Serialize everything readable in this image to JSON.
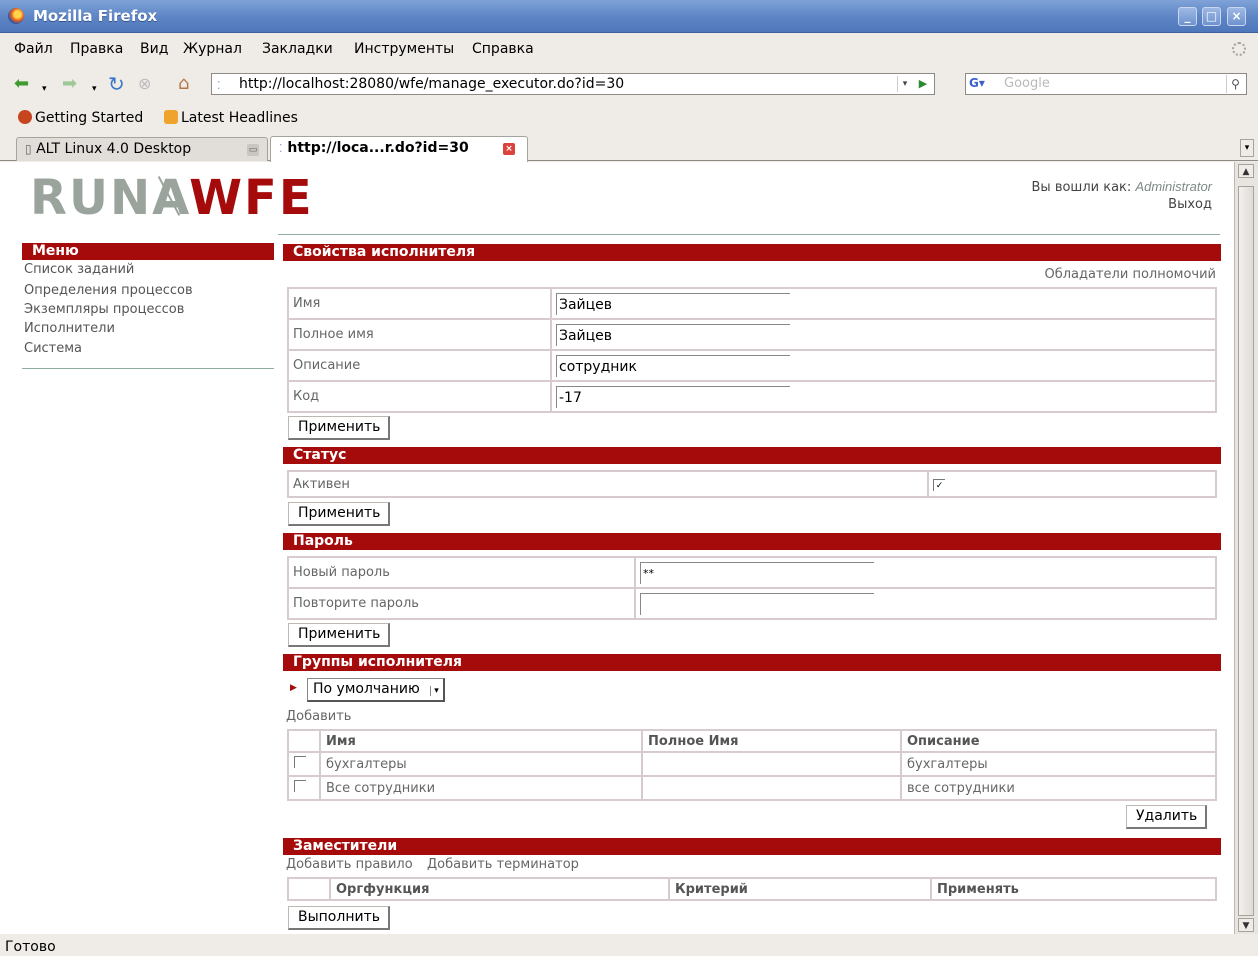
{
  "browser": {
    "window_title": "Mozilla Firefox",
    "menu": [
      "Файл",
      "Правка",
      "Вид",
      "Журнал",
      "Закладки",
      "Инструменты",
      "Справка"
    ],
    "url": "http://localhost:28080/wfe/manage_executor.do?id=30",
    "search_placeholder": "Google",
    "bookmarks": [
      "Getting Started",
      "Latest Headlines"
    ],
    "tabs": [
      "ALT Linux 4.0 Desktop",
      "http://loca...r.do?id=30"
    ],
    "status": "Готово"
  },
  "header": {
    "logo_part1": "RUNA",
    "logo_part2": "WFE",
    "logged_in_label": "Вы вошли как:",
    "user": "Administrator",
    "logout": "Выход"
  },
  "sidebar": {
    "title": "Меню",
    "items": [
      "Список заданий",
      "Определения процессов",
      "Экземпляры процессов",
      "Исполнители",
      "Система"
    ]
  },
  "properties": {
    "title": "Свойства исполнителя",
    "permissions_link": "Обладатели полномочий",
    "rows": [
      {
        "label": "Имя",
        "value": "Зайцев"
      },
      {
        "label": "Полное имя",
        "value": "Зайцев"
      },
      {
        "label": "Описание",
        "value": "сотрудник"
      },
      {
        "label": "Код",
        "value": "-17"
      }
    ],
    "apply": "Применить"
  },
  "status": {
    "title": "Статус",
    "active_label": "Активен",
    "active_checked": true,
    "apply": "Применить"
  },
  "password": {
    "title": "Пароль",
    "new_label": "Новый пароль",
    "new_value": "**",
    "repeat_label": "Повторите пароль",
    "repeat_value": "",
    "apply": "Применить"
  },
  "groups": {
    "title": "Группы исполнителя",
    "filter_selected": "По умолчанию",
    "add": "Добавить",
    "columns": [
      "Имя",
      "Полное Имя",
      "Описание"
    ],
    "rows": [
      {
        "name": "бухгалтеры",
        "full_name": "",
        "description": "бухгалтеры"
      },
      {
        "name": "Все сотрудники",
        "full_name": "",
        "description": "все сотрудники"
      }
    ],
    "delete": "Удалить"
  },
  "substitutes": {
    "title": "Заместители",
    "add_rule": "Добавить правило",
    "add_terminator": "Добавить терминатор",
    "columns": [
      "Оргфункция",
      "Критерий",
      "Применять"
    ],
    "execute": "Выполнить"
  }
}
